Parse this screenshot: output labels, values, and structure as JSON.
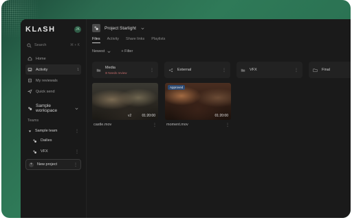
{
  "sidebar": {
    "logo": "KLʌSH",
    "avatar_initials": "JK",
    "search": {
      "label": "Search",
      "shortcut": "⌘ + K"
    },
    "nav": [
      {
        "label": "Home",
        "icon": "home-icon",
        "count": ""
      },
      {
        "label": "Activity",
        "icon": "inbox-icon",
        "count": "1"
      },
      {
        "label": "My reviewals",
        "icon": "review-icon",
        "count": ""
      },
      {
        "label": "Quick send",
        "icon": "send-icon",
        "count": ""
      }
    ],
    "workspace": "Sample workspace",
    "teams_label": "Teams",
    "team": "Sample team",
    "projects": [
      {
        "label": "Dailies"
      },
      {
        "label": "VFX"
      }
    ],
    "new_project": "New project",
    "kebab": "⋮"
  },
  "main": {
    "project_title": "Project Starlight",
    "tabs": [
      "Files",
      "Activity",
      "Share links",
      "Playlists"
    ],
    "sort_label": "Newest",
    "filter_label": "+ Filter",
    "folders": [
      {
        "name": "Media",
        "sub": "⦻ Needs review",
        "icon": "folder-icon"
      },
      {
        "name": "External",
        "sub": "",
        "icon": "share-icon"
      },
      {
        "name": "VFX",
        "sub": "",
        "icon": "folder-icon"
      },
      {
        "name": "Final",
        "sub": "",
        "icon": "folder-outline-icon"
      }
    ],
    "assets": [
      {
        "name": "castle.mov",
        "duration": "01:20:00",
        "version": "v2",
        "badge": ""
      },
      {
        "name": "moment.mov",
        "duration": "01:20:00",
        "version": "",
        "badge": "Approved"
      }
    ]
  },
  "colors": {
    "background_green": "#2f7a58",
    "app_bg": "#1a1a1a",
    "sidebar_bg": "#191919",
    "accent_green": "#9fe0bd",
    "needs_review_red": "#c06a6a",
    "approved_blue": "#285082"
  }
}
